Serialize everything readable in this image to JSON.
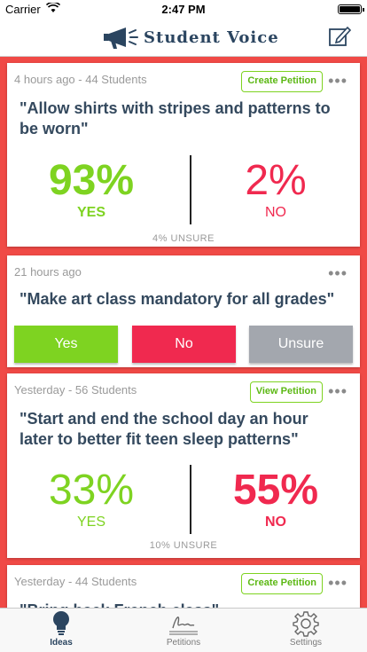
{
  "status_bar": {
    "carrier": "Carrier",
    "time": "2:47 PM",
    "battery_level": 1.0
  },
  "navbar": {
    "title": "Student Voice",
    "logo_icon": "megaphone-icon",
    "compose_icon": "compose-icon"
  },
  "cards": [
    {
      "meta": "4 hours ago - 44 Students",
      "petition_label": "Create Petition",
      "question": "\"Allow shirts with stripes and patterns to be worn\"",
      "yes_pct": "93%",
      "yes_label": "YES",
      "no_pct": "2%",
      "no_label": "NO",
      "unsure": "4% UNSURE"
    },
    {
      "meta": "21 hours ago",
      "question": "\"Make art class mandatory for all grades\"",
      "buttons": {
        "yes": "Yes",
        "no": "No",
        "unsure": "Unsure"
      }
    },
    {
      "meta": "Yesterday - 56 Students",
      "petition_label": "View Petition",
      "question": "\"Start and end the school day an hour later to better fit teen sleep patterns\"",
      "yes_pct": "33%",
      "yes_label": "YES",
      "no_pct": "55%",
      "no_label": "NO",
      "unsure": "10% UNSURE"
    },
    {
      "meta": "Yesterday - 44 Students",
      "petition_label": "Create Petition",
      "question": "\"Bring back French class\""
    }
  ],
  "tabs": [
    {
      "label": "Ideas",
      "icon": "lightbulb-icon",
      "active": true
    },
    {
      "label": "Petitions",
      "icon": "signature-icon",
      "active": false
    },
    {
      "label": "Settings",
      "icon": "gear-icon",
      "active": false
    }
  ],
  "colors": {
    "background": "#f04a46",
    "yes": "#7ed321",
    "no": "#f0294f",
    "unsure": "#a3a7ae",
    "title": "#2b4560"
  }
}
